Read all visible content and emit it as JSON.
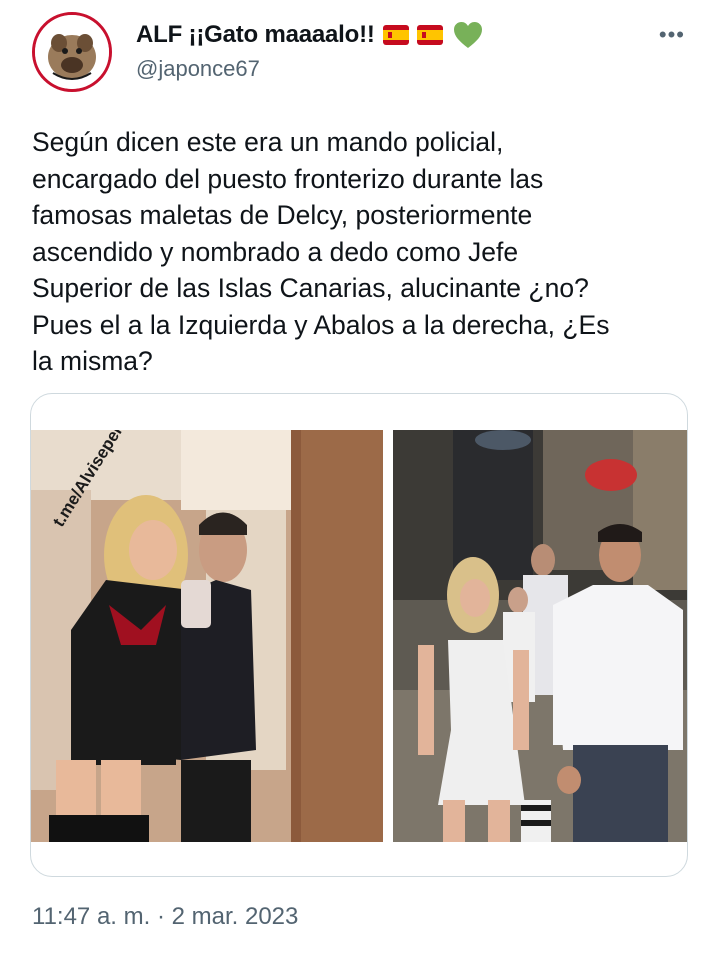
{
  "user": {
    "display_name": "ALF ¡¡Gato maaaalo!!",
    "handle": "@japonce67",
    "icons": [
      "spain-flag-icon",
      "spain-flag-icon",
      "green-heart-icon"
    ]
  },
  "menu": {
    "more_label": "•••"
  },
  "tweet": {
    "text": "Según dicen este era un mando policial,\nencargado del puesto fronterizo durante las\nfamosas maletas de Delcy, posteriormente\nascendido y nombrado a dedo como Jefe\nSuperior de las Islas Canarias, alucinante ¿no?\nPues el a la Izquierda y Abalos a la derecha, ¿Es\nla misma?",
    "timestamp": "11:47 a. m. · 2 mar. 2023"
  },
  "media": {
    "left_photo_watermark": "t.me/Alviseperez"
  },
  "colors": {
    "text": "#0f1419",
    "secondary": "#536471",
    "border": "#cfd9de",
    "flag_red": "#c60b1e",
    "flag_yellow": "#ffc400",
    "heart_green": "#78b159"
  }
}
